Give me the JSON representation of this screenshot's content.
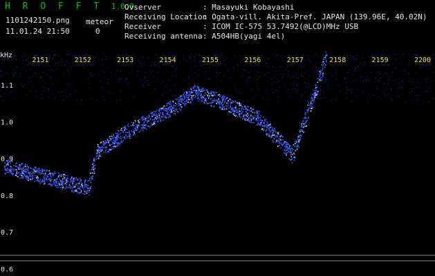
{
  "header": {
    "app_name": "H R O F F T",
    "app_version": "1.0.0",
    "file_name": "1101242150.png",
    "datetime": "11.01.24 21:50",
    "meteor_label": "meteor",
    "meteor_count": "0",
    "info_rows": [
      {
        "label": "Ovserver",
        "value": ": Masayuki Kobayashi"
      },
      {
        "label": "Receiving Location",
        "value": ": Ogata-vill. Akita-Pref. JAPAN (139.96E, 40.02N)"
      },
      {
        "label": "Receiver",
        "value": ": ICOM IC-575 53.7492(@LCD)MHz USB"
      },
      {
        "label": "Receiving antenna",
        "value": ": A504HB(yagi 4el)"
      }
    ]
  },
  "chart_data": {
    "type": "heatmap",
    "ylabel": "kHz",
    "x_ticks": [
      "2151",
      "2152",
      "2153",
      "2154",
      "2155",
      "2156",
      "2157",
      "2158",
      "2159",
      "2200"
    ],
    "x_range": [
      "2150",
      "2200"
    ],
    "y_ticks": [
      "1.1",
      "1.0",
      "0.9",
      "0.8",
      "0.7",
      "0.6"
    ],
    "ylim": [
      0.58,
      1.2
    ],
    "signal_trace": [
      {
        "t": "2150",
        "khz": 0.88
      },
      {
        "t": "2151",
        "khz": 0.85
      },
      {
        "t": "2152",
        "khz": 0.82
      },
      {
        "t": "2152.2",
        "khz": 0.92
      },
      {
        "t": "2153",
        "khz": 0.98
      },
      {
        "t": "2154",
        "khz": 1.04
      },
      {
        "t": "2154.5",
        "khz": 1.08
      },
      {
        "t": "2155",
        "khz": 1.06
      },
      {
        "t": "2156",
        "khz": 1.01
      },
      {
        "t": "2156.8",
        "khz": 0.91
      },
      {
        "t": "2157.3",
        "khz": 1.07
      },
      {
        "t": "2157.6",
        "khz": 1.18
      }
    ],
    "colors": {
      "background": "#000000",
      "signal": "#3c5aff",
      "signal_bright": "#c8d2ff",
      "noise": "#141e8c",
      "ticks": "#e6e641",
      "labels": "#e6e6e6",
      "logo": "#00c800"
    }
  }
}
